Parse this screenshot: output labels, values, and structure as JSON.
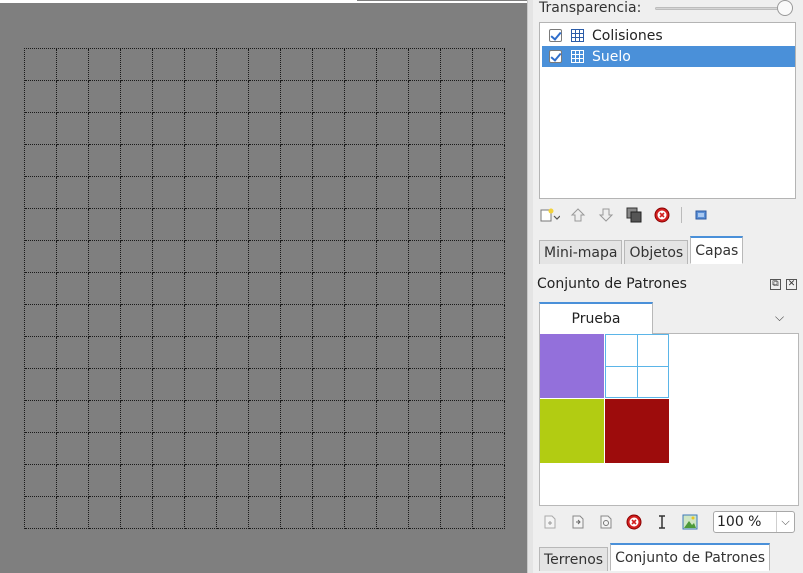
{
  "layers_panel": {
    "transparency_label": "Transparencia:",
    "transparency_value_pct": 100,
    "layers": [
      {
        "name": "Colisiones",
        "visible": true,
        "selected": false
      },
      {
        "name": "Suelo",
        "visible": true,
        "selected": true
      }
    ],
    "toolbar_icons": [
      "new-layer-icon",
      "raise-layer-icon",
      "lower-layer-icon",
      "duplicate-layer-icon",
      "remove-layer-icon",
      "show-other-layers-icon"
    ],
    "tabs": [
      {
        "label": "Mini-mapa",
        "active": false
      },
      {
        "label": "Objetos",
        "active": false
      },
      {
        "label": "Capas",
        "active": true
      }
    ]
  },
  "tileset_panel": {
    "title": "Conjunto de Patrones",
    "tileset_tab": "Prueba",
    "tiles": [
      {
        "kind": "color",
        "color": "#9370db"
      },
      {
        "kind": "empty-grid",
        "color": "#5bb5e8"
      },
      {
        "kind": "color",
        "color": "#b2cc12"
      },
      {
        "kind": "color",
        "color": "#9d0c0c"
      }
    ],
    "zoom": "100 %",
    "toolbar_icons": [
      "new-tileset-icon",
      "import-tileset-icon",
      "edit-tileset-icon",
      "remove-tileset-icon",
      "edit-terrain-icon",
      "tileset-image-icon"
    ],
    "tabs": [
      {
        "label": "Terrenos",
        "active": false
      },
      {
        "label": "Conjunto de Patrones",
        "active": true
      }
    ]
  },
  "map": {
    "columns": 15,
    "rows": 15,
    "background": "#7f7f7f"
  },
  "colors": {
    "selection": "#4a90d9",
    "grid_line": "#1a1a1a"
  }
}
